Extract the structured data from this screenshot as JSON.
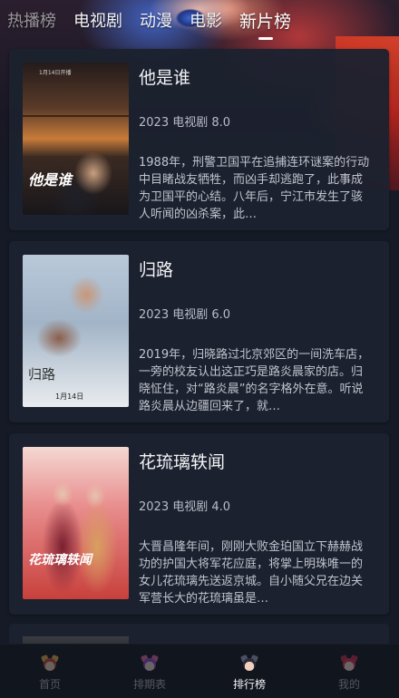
{
  "top_tabs": [
    {
      "label": "热播榜",
      "active": false
    },
    {
      "label": "电视剧",
      "active": false
    },
    {
      "label": "动漫",
      "active": false
    },
    {
      "label": "电影",
      "active": false
    },
    {
      "label": "新片榜",
      "active": true
    }
  ],
  "cards": [
    {
      "title": "他是谁",
      "year": "2023",
      "genre": "电视剧",
      "rating": "8.0",
      "meta": "2023 电视剧 8.0",
      "description": "1988年，刑警卫国平在追捕连环谜案的行动中目睹战友牺牲，而凶手却逃跑了，此事成为卫国平的心结。八年后，宁江市发生了骇人听闻的凶杀案，此…",
      "poster": {
        "title": "他是谁",
        "top_text": "1月14日开播",
        "sub": ""
      }
    },
    {
      "title": "归路",
      "year": "2023",
      "genre": "电视剧",
      "rating": "6.0",
      "meta": "2023 电视剧 6.0",
      "description": "2019年，归晓路过北京郊区的一间洗车店，一旁的校友认出这正巧是路炎晨家的店。归晓怔住，对“路炎晨”的名字格外在意。听说路炎晨从边疆回来了，就…",
      "poster": {
        "title": "归路",
        "top_text": "",
        "sub": "1月14日"
      }
    },
    {
      "title": "花琉璃轶闻",
      "year": "2023",
      "genre": "电视剧",
      "rating": "4.0",
      "meta": "2023 电视剧 4.0",
      "description": "大晋昌隆年间，刚刚大败金珀国立下赫赫战功的护国大将军花应庭，将掌上明珠唯一的女儿花琉璃先送返京城。自小随父兄在边关军营长大的花琉璃虽是…",
      "poster": {
        "title": "花琉璃轶闻",
        "top_text": "",
        "sub": ""
      }
    }
  ],
  "bottom_nav": [
    {
      "label": "首页",
      "icon": "home-avatar-icon",
      "active": false
    },
    {
      "label": "排期表",
      "icon": "schedule-avatar-icon",
      "active": false
    },
    {
      "label": "排行榜",
      "icon": "ranking-avatar-icon",
      "active": true
    },
    {
      "label": "我的",
      "icon": "profile-avatar-icon",
      "active": false
    }
  ],
  "colors": {
    "background": "#151a26",
    "card": "#1c212f",
    "nav_bg": "#11151e",
    "text_primary": "#f2f3f6",
    "text_secondary": "#b9bdc8"
  }
}
